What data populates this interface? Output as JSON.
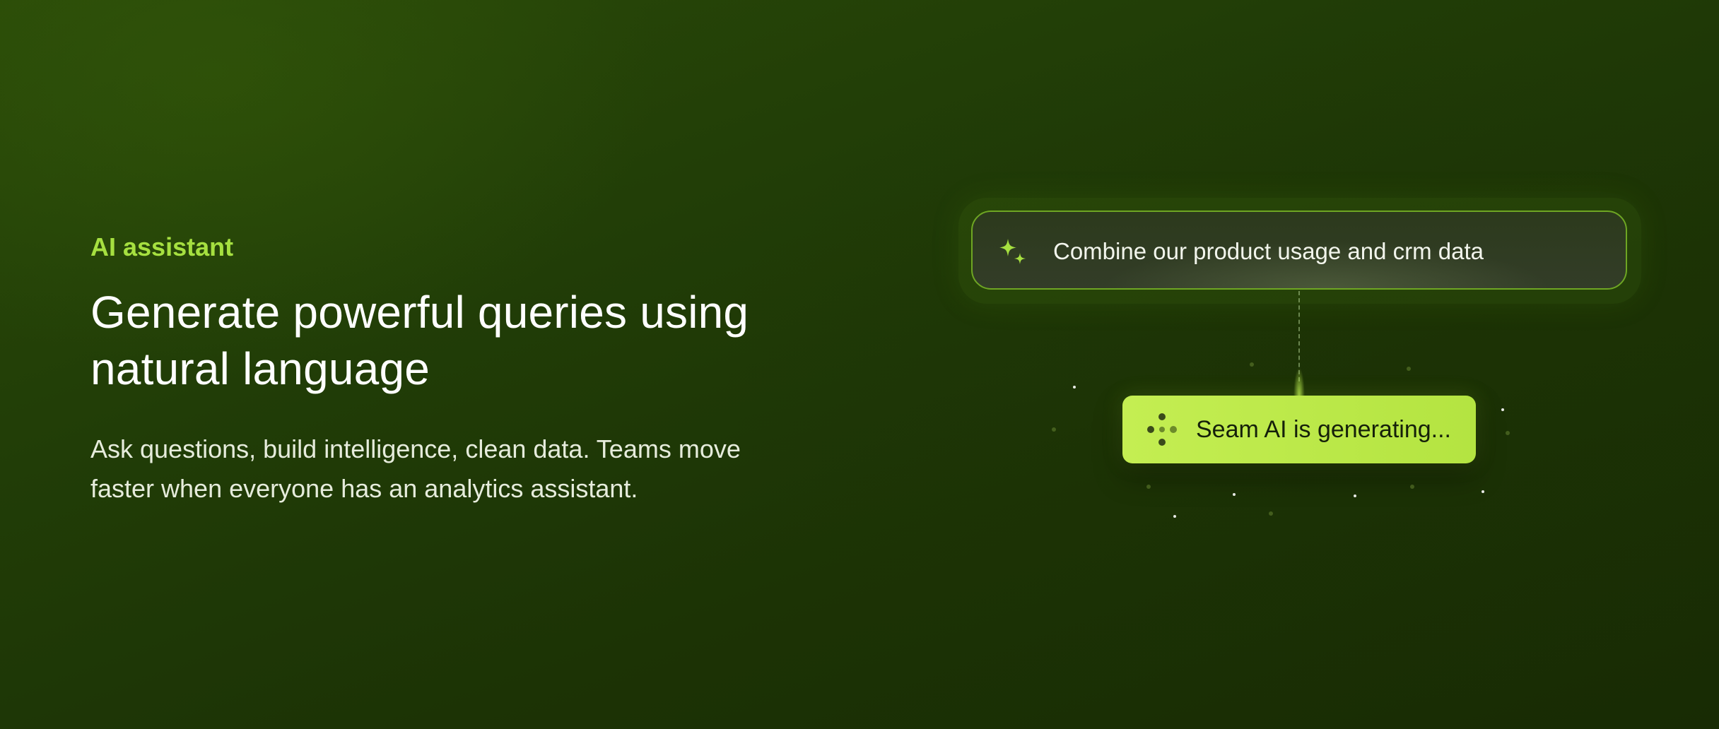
{
  "hero": {
    "eyebrow": "AI assistant",
    "headline": "Generate powerful queries using natural language",
    "subtext": "Ask questions, build intelligence, clean data. Teams move faster when everyone has an analytics assistant."
  },
  "widget": {
    "prompt_icon": "sparkle-icon",
    "prompt_text": "Combine our product usage and crm data",
    "status_icon": "loading-dots-icon",
    "status_text": "Seam AI is generating..."
  },
  "colors": {
    "accent": "#a6e040",
    "pill": "#c4ee52",
    "background": "#213d07"
  }
}
